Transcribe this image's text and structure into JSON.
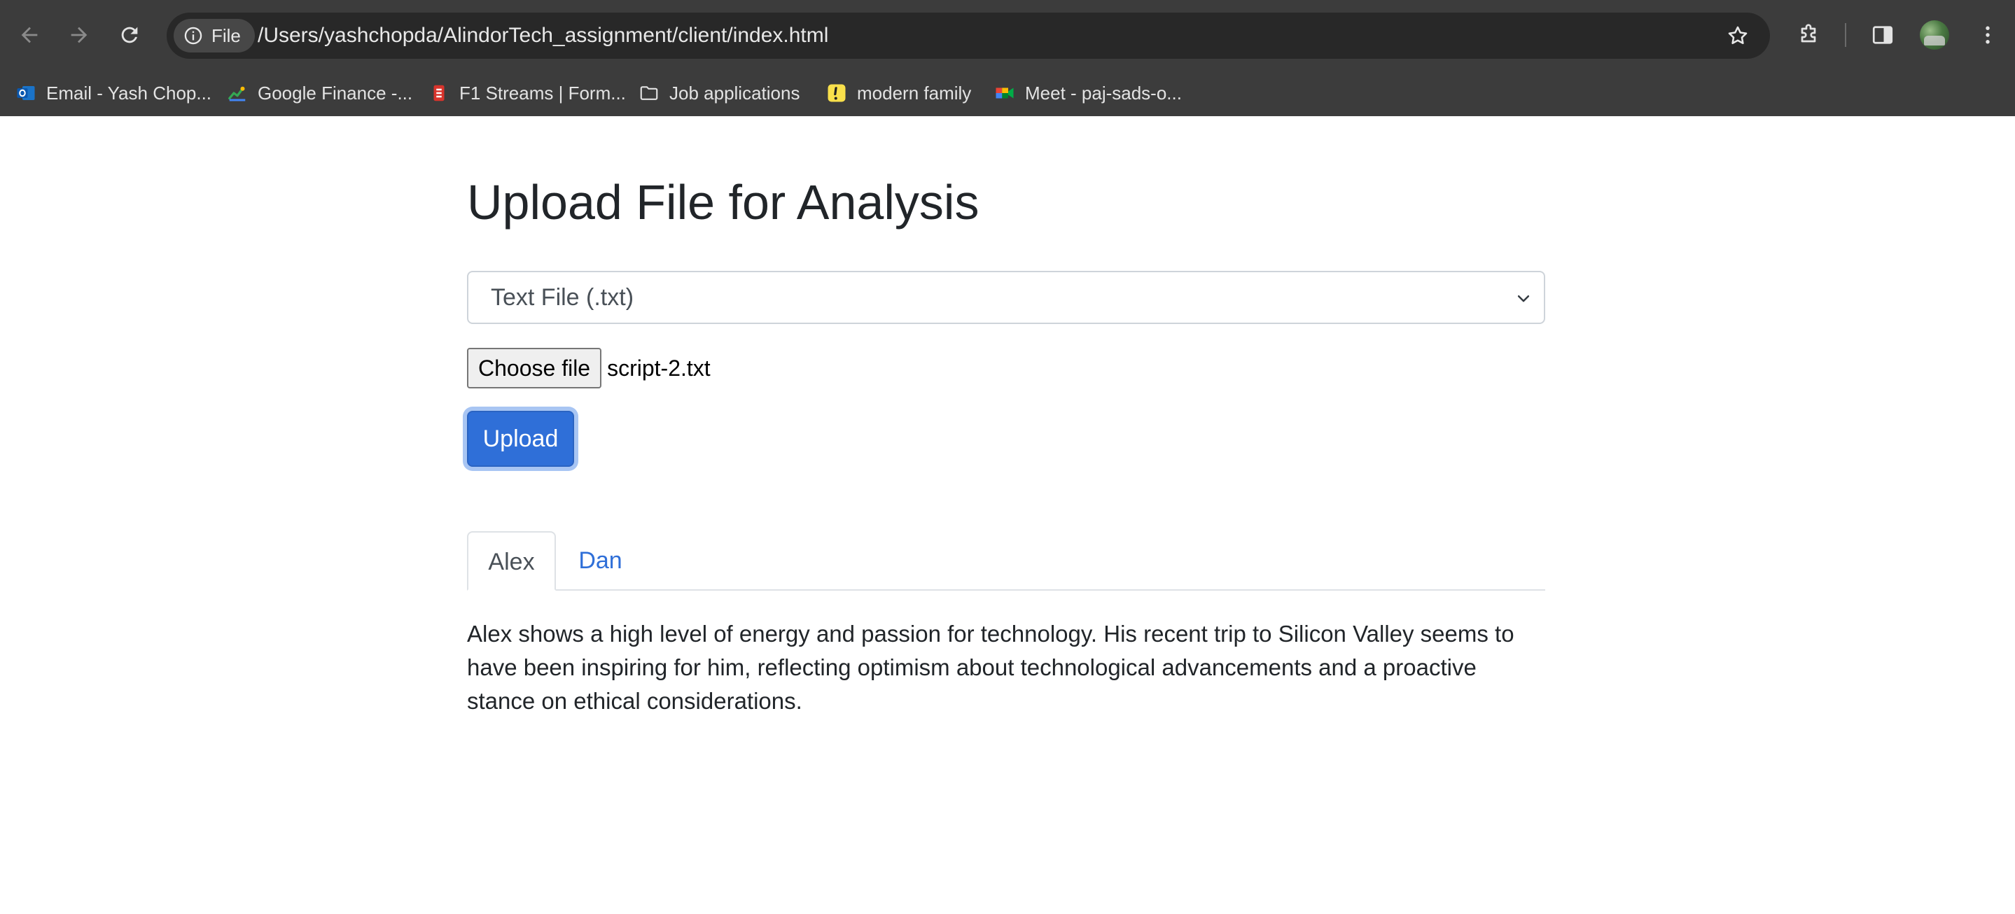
{
  "browser": {
    "chip_label": "File",
    "url": "/Users/yashchopda/AlindorTech_assignment/client/index.html",
    "icons": {
      "back": "arrow-left-icon",
      "forward": "arrow-right-icon",
      "reload": "reload-icon",
      "site_info": "info-icon",
      "bookmark": "star-icon",
      "extensions": "puzzle-icon",
      "side_panel": "side-panel-icon",
      "profile": "avatar"
    },
    "bookmarks": [
      {
        "label": "Email - Yash Chop...",
        "icon": "outlook-icon"
      },
      {
        "label": "Google Finance -...",
        "icon": "google-finance-icon"
      },
      {
        "label": "F1 Streams | Form...",
        "icon": "f1-streams-icon"
      },
      {
        "label": "Job applications",
        "icon": "folder-icon"
      },
      {
        "label": "modern family",
        "icon": "exclamation-icon"
      },
      {
        "label": "Meet - paj-sads-o...",
        "icon": "google-meet-icon"
      }
    ],
    "colors": {
      "chrome_bg": "#3c3c3c",
      "omnibox_bg": "#282828",
      "text": "#e8e8e8"
    }
  },
  "page": {
    "title": "Upload File for Analysis",
    "file_type_select": {
      "selected": "Text File (.txt)"
    },
    "file_input": {
      "button_label": "Choose file",
      "file_name": "script-2.txt"
    },
    "upload_button": "Upload",
    "tabs": [
      {
        "label": "Alex",
        "active": true
      },
      {
        "label": "Dan",
        "active": false
      }
    ],
    "analysis_text": "Alex shows a high level of energy and passion for technology. His recent trip to Silicon Valley seems to have been inspiring for him, reflecting optimism about technological advancements and a proactive stance on ethical considerations.",
    "colors": {
      "primary": "#2f6fd8",
      "heading": "#212529",
      "border": "#dee2e6"
    }
  }
}
